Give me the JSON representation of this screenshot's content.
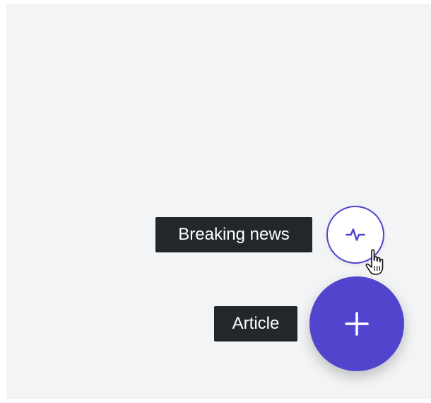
{
  "speed_dial": {
    "actions": [
      {
        "label": "Breaking news",
        "icon": "activity-pulse-icon"
      },
      {
        "label": "Article",
        "icon": "plus-icon"
      }
    ]
  },
  "colors": {
    "accent": "#5145cd",
    "tooltip_bg": "#23272b",
    "canvas_bg": "#f3f4f6"
  },
  "cursor": {
    "icon": "hand-pointer-icon"
  }
}
